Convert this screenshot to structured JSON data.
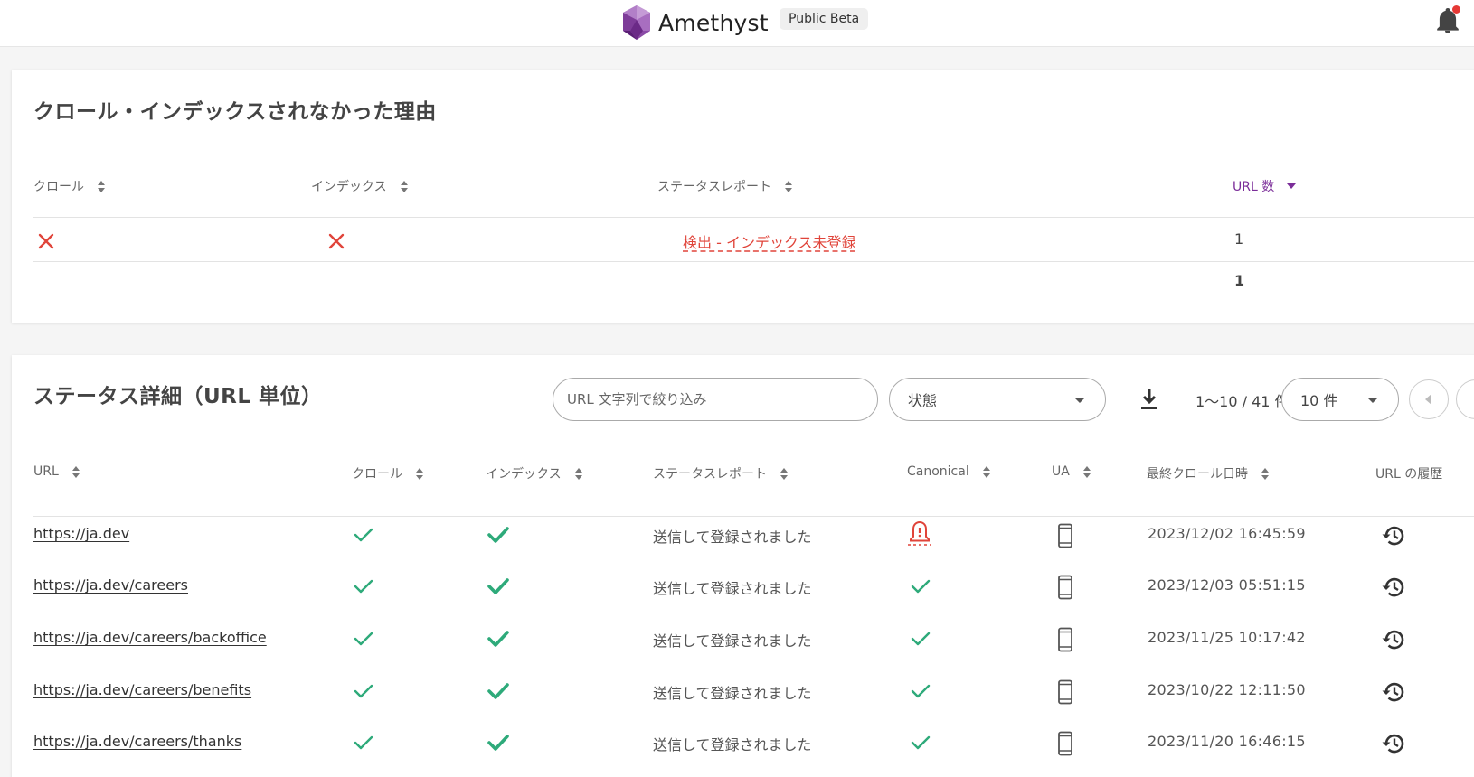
{
  "header": {
    "brand": "Amethyst",
    "badge": "Public Beta",
    "icons": {
      "logo": "amethyst-gem-logo",
      "bell": "notification-bell-icon"
    },
    "accent_color": "#7b2d99",
    "notification_dot_color": "#e53935"
  },
  "reasons": {
    "title": "クロール・インデックスされなかった理由",
    "columns": {
      "crawl": "クロール",
      "index": "インデックス",
      "status": "ステータスレポート",
      "count": "URL 数"
    },
    "rows": [
      {
        "crawl": "x-icon",
        "index": "x-icon",
        "status": "検出 - インデックス未登録",
        "count": "1"
      }
    ],
    "total": "1"
  },
  "details": {
    "title": "ステータス詳細（URL 単位）",
    "search_placeholder": "URL 文字列で絞り込み",
    "state_select": "状態",
    "range": "1〜10 / 41 件",
    "page_size": "10 件",
    "columns": {
      "url": "URL",
      "crawl": "クロール",
      "index": "インデックス",
      "status": "ステータスレポート",
      "canonical": "Canonical",
      "ua": "UA",
      "last_crawl": "最終クロール日時",
      "history": "URL の履歴"
    },
    "rows": [
      {
        "url": "https://ja.dev",
        "status": "送信して登録されました",
        "canonical": "warning-bell-icon",
        "date": "2023/12/02 16:45:59"
      },
      {
        "url": "https://ja.dev/careers",
        "status": "送信して登録されました",
        "canonical": "check-icon",
        "date": "2023/12/03 05:51:15"
      },
      {
        "url": "https://ja.dev/careers/backoffice",
        "status": "送信して登録されました",
        "canonical": "check-icon",
        "date": "2023/11/25 10:17:42"
      },
      {
        "url": "https://ja.dev/careers/benefits",
        "status": "送信して登録されました",
        "canonical": "check-icon",
        "date": "2023/10/22 12:11:50"
      },
      {
        "url": "https://ja.dev/careers/thanks",
        "status": "送信して登録されました",
        "canonical": "check-icon",
        "date": "2023/11/20 16:46:15"
      }
    ]
  },
  "colors": {
    "check": "#2eaa7a",
    "error": "#e0443a"
  }
}
